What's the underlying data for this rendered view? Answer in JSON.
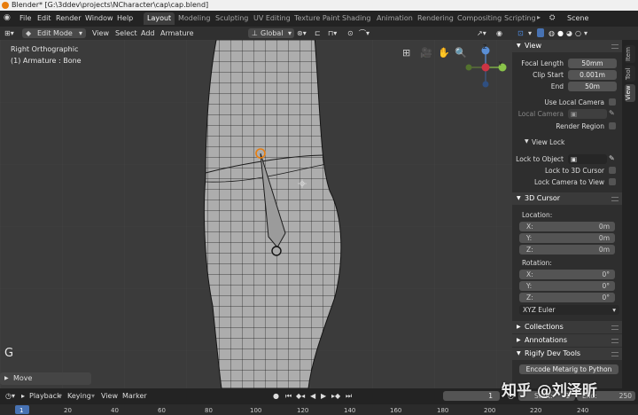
{
  "window": {
    "title": "Blender* [G:\\3ddev\\projects\\NCharacter\\cap\\cap.blend]"
  },
  "menubar": {
    "items": [
      "File",
      "Edit",
      "Render",
      "Window",
      "Help"
    ],
    "workspaces": [
      "Layout",
      "Modeling",
      "Sculpting",
      "UV Editing",
      "Texture Paint",
      "Shading",
      "Animation",
      "Rendering",
      "Compositing",
      "Scripting"
    ],
    "active_workspace": "Layout",
    "scene": "Scene"
  },
  "viewport_header": {
    "mode": "Edit Mode",
    "menus": [
      "View",
      "Select",
      "Add",
      "Armature"
    ],
    "transform_orientation": "Global"
  },
  "viewport": {
    "view_name": "Right Orthographic",
    "object_info": "(1) Armature : Bone",
    "axis_y_label": "Y",
    "axis_z_label": "Z",
    "grab_indicator": "G",
    "operator": "Move"
  },
  "sidebar": {
    "tabs": [
      "Item",
      "Tool",
      "View"
    ],
    "active_tab": "View",
    "view_panel": {
      "title": "View",
      "focal_length_label": "Focal Length",
      "focal_length": "50mm",
      "clip_start_label": "Clip Start",
      "clip_start": "0.001m",
      "end_label": "End",
      "end": "50m",
      "use_local_camera": "Use Local Camera",
      "local_camera_label": "Local Camera",
      "render_region": "Render Region",
      "view_lock_title": "View Lock",
      "lock_to_object_label": "Lock to Object",
      "lock_to_3d_cursor": "Lock to 3D Cursor",
      "lock_camera_to_view": "Lock Camera to View"
    },
    "cursor_panel": {
      "title": "3D Cursor",
      "location_label": "Location:",
      "loc": [
        {
          "axis": "X:",
          "value": "0m"
        },
        {
          "axis": "Y:",
          "value": "0m"
        },
        {
          "axis": "Z:",
          "value": "0m"
        }
      ],
      "rotation_label": "Rotation:",
      "rot": [
        {
          "axis": "X:",
          "value": "0°"
        },
        {
          "axis": "Y:",
          "value": "0°"
        },
        {
          "axis": "Z:",
          "value": "0°"
        }
      ],
      "rotation_mode": "XYZ Euler"
    },
    "collections": "Collections",
    "annotations": "Annotations",
    "rigify_title": "Rigify Dev Tools",
    "encode_metarig": "Encode Metarig to Python"
  },
  "timeline": {
    "menus": [
      "Playback",
      "Keying",
      "View",
      "Marker"
    ],
    "current_frame": "1",
    "start_label": "Start:",
    "start": "1",
    "end_label": "End:",
    "end": "250"
  },
  "ruler": {
    "ticks": [
      "1",
      "20",
      "40",
      "60",
      "80",
      "100",
      "120",
      "140",
      "160",
      "180",
      "200",
      "220",
      "240"
    ]
  },
  "watermark": "知乎 @刘泽昕",
  "colors": {
    "accent": "#4772b3",
    "workspace_active": "#3d3d3d",
    "bone_selected": "#e87d0d"
  }
}
